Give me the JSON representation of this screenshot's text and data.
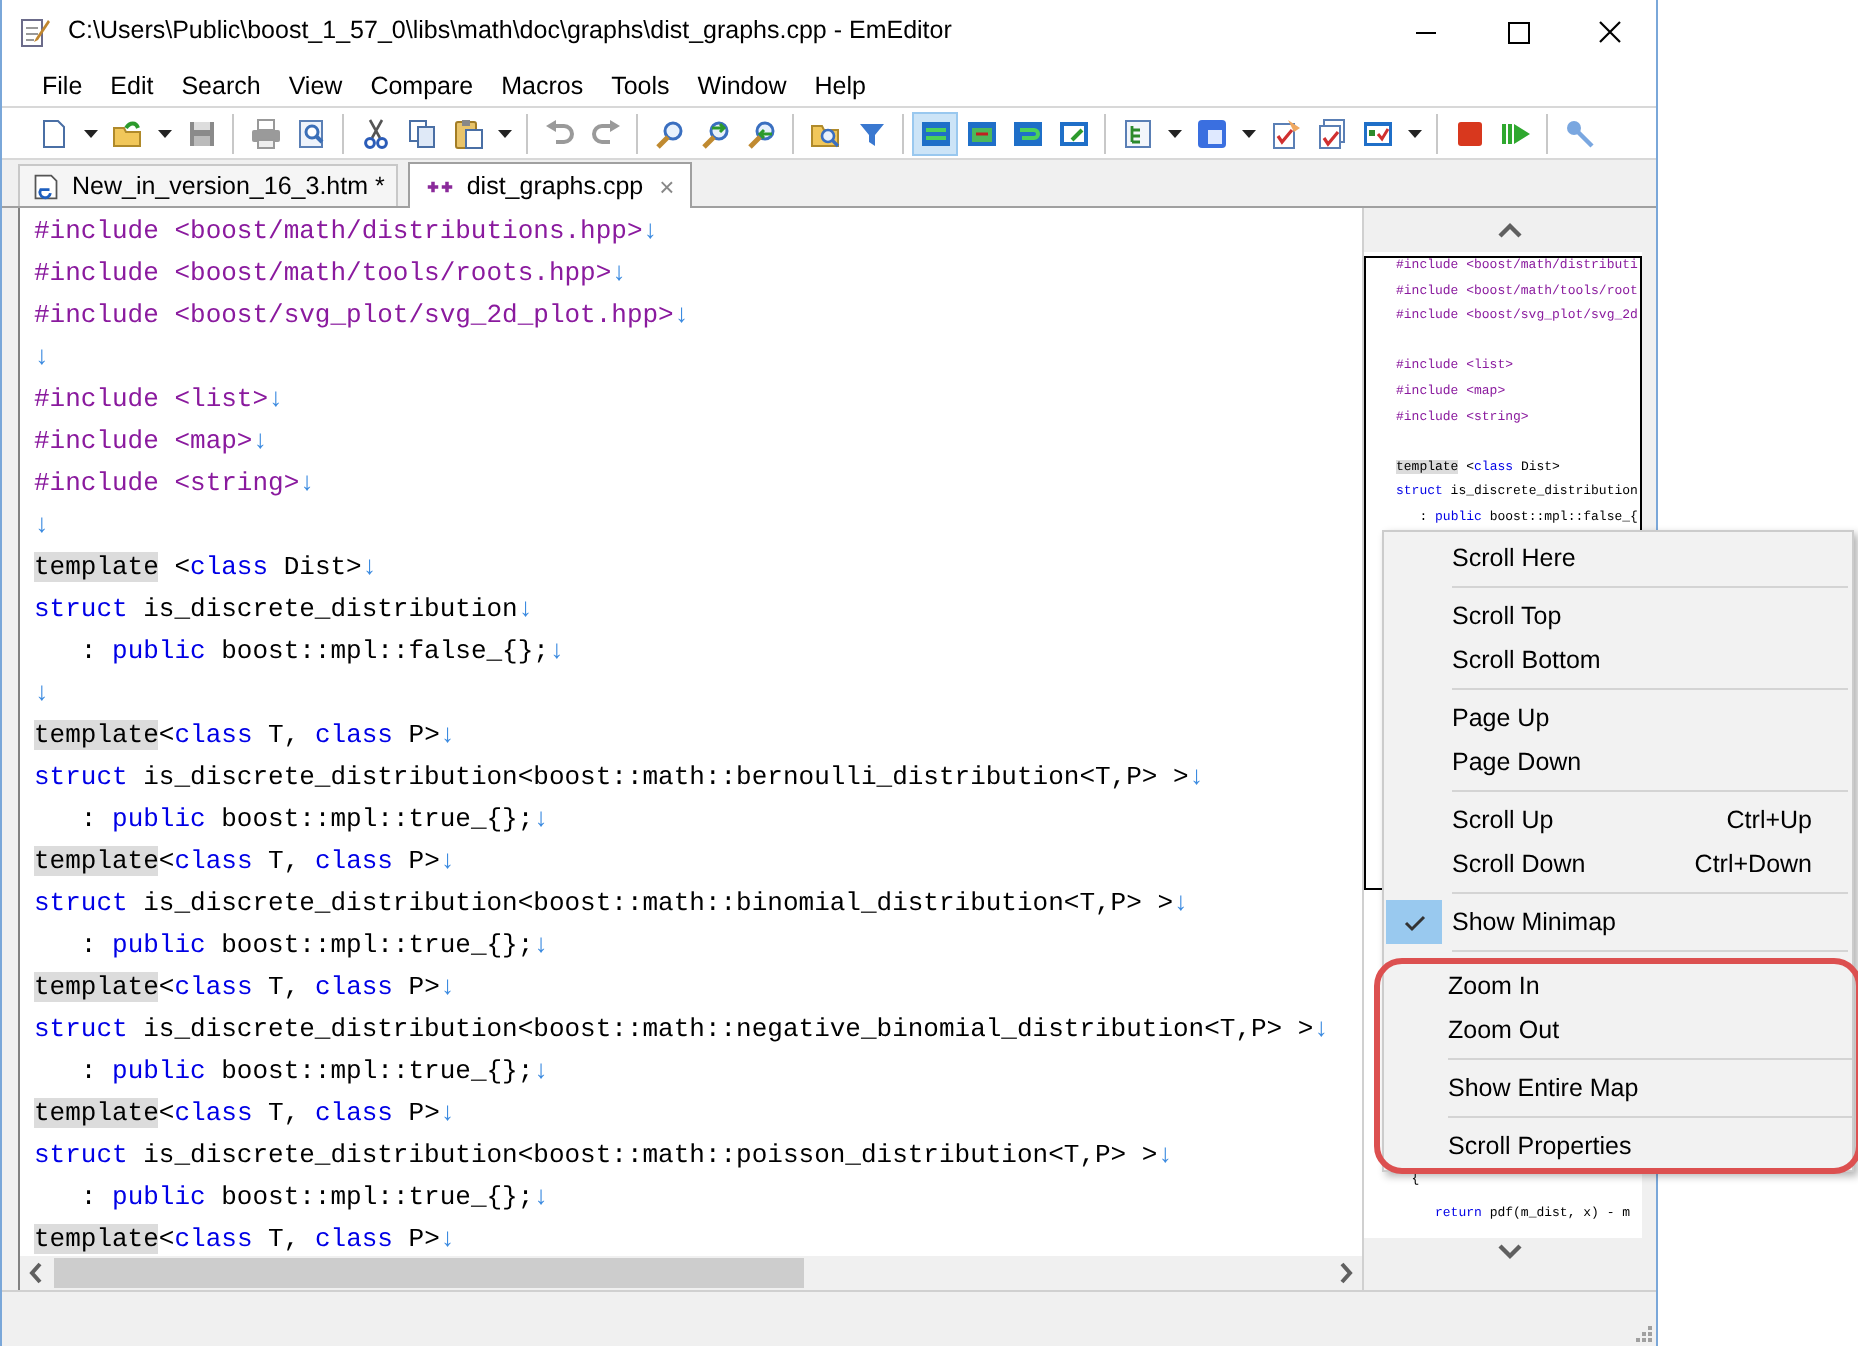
{
  "window": {
    "title": "C:\\Users\\Public\\boost_1_57_0\\libs\\math\\doc\\graphs\\dist_graphs.cpp - EmEditor"
  },
  "menu_bar": [
    "File",
    "Edit",
    "Search",
    "View",
    "Compare",
    "Macros",
    "Tools",
    "Window",
    "Help"
  ],
  "toolbar": [
    {
      "kind": "button",
      "selected": false
    },
    {
      "kind": "dropdown"
    },
    {
      "kind": "button",
      "selected": false
    },
    {
      "kind": "dropdown"
    },
    {
      "kind": "button",
      "selected": false
    },
    {
      "kind": "separator"
    },
    {
      "kind": "button",
      "selected": false
    },
    {
      "kind": "button",
      "selected": false
    },
    {
      "kind": "separator"
    },
    {
      "kind": "button",
      "selected": false
    },
    {
      "kind": "button",
      "selected": false
    },
    {
      "kind": "button",
      "selected": false
    },
    {
      "kind": "dropdown"
    },
    {
      "kind": "separator"
    },
    {
      "kind": "button",
      "selected": false
    },
    {
      "kind": "button",
      "selected": false
    },
    {
      "kind": "separator"
    },
    {
      "kind": "button",
      "selected": false
    },
    {
      "kind": "button",
      "selected": false
    },
    {
      "kind": "button",
      "selected": false
    },
    {
      "kind": "separator"
    },
    {
      "kind": "button",
      "selected": false
    },
    {
      "kind": "button",
      "selected": false
    },
    {
      "kind": "separator"
    },
    {
      "kind": "button",
      "selected": true
    },
    {
      "kind": "button",
      "selected": false
    },
    {
      "kind": "button",
      "selected": false
    },
    {
      "kind": "button",
      "selected": false
    },
    {
      "kind": "separator"
    },
    {
      "kind": "button",
      "selected": false
    },
    {
      "kind": "dropdown"
    },
    {
      "kind": "button",
      "selected": false
    },
    {
      "kind": "dropdown"
    },
    {
      "kind": "button",
      "selected": false
    },
    {
      "kind": "button",
      "selected": false
    },
    {
      "kind": "button",
      "selected": false
    },
    {
      "kind": "dropdown"
    },
    {
      "kind": "separator"
    },
    {
      "kind": "button",
      "selected": false
    },
    {
      "kind": "button",
      "selected": false
    },
    {
      "kind": "separator"
    },
    {
      "kind": "button",
      "selected": false
    }
  ],
  "tabs": [
    {
      "label": "New_in_version_16_3.htm *",
      "kind": "html",
      "selected": false
    },
    {
      "label": "dist_graphs.cpp",
      "kind": "cpp",
      "selected": true,
      "close": "×"
    }
  ],
  "code_lines": [
    [
      {
        "kind": "directive",
        "text": "#include <boost/math/distributions.hpp>"
      },
      {
        "kind": "eol",
        "text": "↓"
      }
    ],
    [
      {
        "kind": "directive",
        "text": "#include <boost/math/tools/roots.hpp>"
      },
      {
        "kind": "eol",
        "text": "↓"
      }
    ],
    [
      {
        "kind": "directive",
        "text": "#include <boost/svg_plot/svg_2d_plot.hpp>"
      },
      {
        "kind": "eol",
        "text": "↓"
      }
    ],
    [
      {
        "kind": "eol",
        "text": "↓"
      }
    ],
    [
      {
        "kind": "directive",
        "text": "#include <list>"
      },
      {
        "kind": "eol",
        "text": "↓"
      }
    ],
    [
      {
        "kind": "directive",
        "text": "#include <map>"
      },
      {
        "kind": "eol",
        "text": "↓"
      }
    ],
    [
      {
        "kind": "directive",
        "text": "#include <string>"
      },
      {
        "kind": "eol",
        "text": "↓"
      }
    ],
    [
      {
        "kind": "eol",
        "text": "↓"
      }
    ],
    [
      {
        "kind": "highlight",
        "text": "template"
      },
      {
        "kind": "text",
        "text": " <"
      },
      {
        "kind": "keyword",
        "text": "class"
      },
      {
        "kind": "text",
        "text": " Dist>"
      },
      {
        "kind": "eol",
        "text": "↓"
      }
    ],
    [
      {
        "kind": "keyword",
        "text": "struct"
      },
      {
        "kind": "text",
        "text": " is_discrete_distribution"
      },
      {
        "kind": "eol",
        "text": "↓"
      }
    ],
    [
      {
        "kind": "text",
        "text": "   : "
      },
      {
        "kind": "keyword",
        "text": "public"
      },
      {
        "kind": "text",
        "text": " boost::mpl::false_{};"
      },
      {
        "kind": "eol",
        "text": "↓"
      }
    ],
    [
      {
        "kind": "eol",
        "text": "↓"
      }
    ],
    [
      {
        "kind": "highlight",
        "text": "template"
      },
      {
        "kind": "text",
        "text": "<"
      },
      {
        "kind": "keyword",
        "text": "class"
      },
      {
        "kind": "text",
        "text": " T, "
      },
      {
        "kind": "keyword",
        "text": "class"
      },
      {
        "kind": "text",
        "text": " P>"
      },
      {
        "kind": "eol",
        "text": "↓"
      }
    ],
    [
      {
        "kind": "keyword",
        "text": "struct"
      },
      {
        "kind": "text",
        "text": " is_discrete_distribution<boost::math::bernoulli_distribution<T,P> >"
      },
      {
        "kind": "eol",
        "text": "↓"
      }
    ],
    [
      {
        "kind": "text",
        "text": "   : "
      },
      {
        "kind": "keyword",
        "text": "public"
      },
      {
        "kind": "text",
        "text": " boost::mpl::true_{};"
      },
      {
        "kind": "eol",
        "text": "↓"
      }
    ],
    [
      {
        "kind": "highlight",
        "text": "template"
      },
      {
        "kind": "text",
        "text": "<"
      },
      {
        "kind": "keyword",
        "text": "class"
      },
      {
        "kind": "text",
        "text": " T, "
      },
      {
        "kind": "keyword",
        "text": "class"
      },
      {
        "kind": "text",
        "text": " P>"
      },
      {
        "kind": "eol",
        "text": "↓"
      }
    ],
    [
      {
        "kind": "keyword",
        "text": "struct"
      },
      {
        "kind": "text",
        "text": " is_discrete_distribution<boost::math::binomial_distribution<T,P> >"
      },
      {
        "kind": "eol",
        "text": "↓"
      }
    ],
    [
      {
        "kind": "text",
        "text": "   : "
      },
      {
        "kind": "keyword",
        "text": "public"
      },
      {
        "kind": "text",
        "text": " boost::mpl::true_{};"
      },
      {
        "kind": "eol",
        "text": "↓"
      }
    ],
    [
      {
        "kind": "highlight",
        "text": "template"
      },
      {
        "kind": "text",
        "text": "<"
      },
      {
        "kind": "keyword",
        "text": "class"
      },
      {
        "kind": "text",
        "text": " T, "
      },
      {
        "kind": "keyword",
        "text": "class"
      },
      {
        "kind": "text",
        "text": " P>"
      },
      {
        "kind": "eol",
        "text": "↓"
      }
    ],
    [
      {
        "kind": "keyword",
        "text": "struct"
      },
      {
        "kind": "text",
        "text": " is_discrete_distribution<boost::math::negative_binomial_distribution<T,P> >"
      },
      {
        "kind": "eol",
        "text": "↓"
      }
    ],
    [
      {
        "kind": "text",
        "text": "   : "
      },
      {
        "kind": "keyword",
        "text": "public"
      },
      {
        "kind": "text",
        "text": " boost::mpl::true_{};"
      },
      {
        "kind": "eol",
        "text": "↓"
      }
    ],
    [
      {
        "kind": "highlight",
        "text": "template"
      },
      {
        "kind": "text",
        "text": "<"
      },
      {
        "kind": "keyword",
        "text": "class"
      },
      {
        "kind": "text",
        "text": " T, "
      },
      {
        "kind": "keyword",
        "text": "class"
      },
      {
        "kind": "text",
        "text": " P>"
      },
      {
        "kind": "eol",
        "text": "↓"
      }
    ],
    [
      {
        "kind": "keyword",
        "text": "struct"
      },
      {
        "kind": "text",
        "text": " is_discrete_distribution<boost::math::poisson_distribution<T,P> >"
      },
      {
        "kind": "eol",
        "text": "↓"
      }
    ],
    [
      {
        "kind": "text",
        "text": "   : "
      },
      {
        "kind": "keyword",
        "text": "public"
      },
      {
        "kind": "text",
        "text": " boost::mpl::true_{};"
      },
      {
        "kind": "eol",
        "text": "↓"
      }
    ],
    [
      {
        "kind": "highlight",
        "text": "template"
      },
      {
        "kind": "text",
        "text": "<"
      },
      {
        "kind": "keyword",
        "text": "class"
      },
      {
        "kind": "text",
        "text": " T, "
      },
      {
        "kind": "keyword",
        "text": "class"
      },
      {
        "kind": "text",
        "text": " P>"
      },
      {
        "kind": "eol",
        "text": "↓"
      }
    ]
  ],
  "minimap": {
    "top_lines": [
      {
        "kind": "code",
        "segments": [
          {
            "kind": "directive",
            "text": "#include <boost/math/distributi"
          }
        ]
      },
      {
        "kind": "code",
        "segments": [
          {
            "kind": "directive",
            "text": "#include <boost/math/tools/root"
          }
        ]
      },
      {
        "kind": "code",
        "segments": [
          {
            "kind": "directive",
            "text": "#include <boost/svg_plot/svg_2d"
          }
        ]
      },
      {
        "kind": "blank"
      },
      {
        "kind": "code",
        "segments": [
          {
            "kind": "directive",
            "text": "#include <list>"
          }
        ]
      },
      {
        "kind": "code",
        "segments": [
          {
            "kind": "directive",
            "text": "#include <map>"
          }
        ]
      },
      {
        "kind": "code",
        "segments": [
          {
            "kind": "directive",
            "text": "#include <string>"
          }
        ]
      },
      {
        "kind": "blank"
      },
      {
        "kind": "code",
        "segments": [
          {
            "kind": "highlight",
            "text": "template"
          },
          {
            "kind": "text",
            "text": " <"
          },
          {
            "kind": "keyword",
            "text": "class"
          },
          {
            "kind": "text",
            "text": " Dist>"
          }
        ]
      },
      {
        "kind": "code",
        "segments": [
          {
            "kind": "keyword",
            "text": "struct"
          },
          {
            "kind": "text",
            "text": " is_discrete_distribution"
          }
        ]
      },
      {
        "kind": "code",
        "segments": [
          {
            "kind": "text",
            "text": "   : "
          },
          {
            "kind": "keyword",
            "text": "public"
          },
          {
            "kind": "text",
            "text": " boost::mpl::false_{"
          }
        ]
      }
    ],
    "bottom_lines": [
      {
        "kind": "code",
        "segments": [
          {
            "kind": "text",
            "text": "  {"
          }
        ]
      },
      {
        "kind": "code",
        "segments": [
          {
            "kind": "keyword",
            "text": "     return"
          },
          {
            "kind": "text",
            "text": " pdf(m_dist, x) - m"
          }
        ]
      }
    ]
  },
  "context_menu": [
    {
      "kind": "item",
      "label": "Scroll Here",
      "checked": false,
      "outlined": false
    },
    {
      "kind": "separator",
      "outlined": false
    },
    {
      "kind": "item",
      "label": "Scroll Top",
      "checked": false,
      "outlined": false
    },
    {
      "kind": "item",
      "label": "Scroll Bottom",
      "checked": false,
      "outlined": false
    },
    {
      "kind": "separator",
      "outlined": false
    },
    {
      "kind": "item",
      "label": "Page Up",
      "checked": false,
      "outlined": false
    },
    {
      "kind": "item",
      "label": "Page Down",
      "checked": false,
      "outlined": false
    },
    {
      "kind": "separator",
      "outlined": false
    },
    {
      "kind": "item",
      "label": "Scroll Up",
      "shortcut": "Ctrl+Up",
      "checked": false,
      "outlined": false
    },
    {
      "kind": "item",
      "label": "Scroll Down",
      "shortcut": "Ctrl+Down",
      "checked": false,
      "outlined": false
    },
    {
      "kind": "separator",
      "outlined": false
    },
    {
      "kind": "item",
      "label": "Show Minimap",
      "checked": true,
      "outlined": false
    },
    {
      "kind": "separator",
      "outlined": false
    },
    {
      "kind": "item",
      "label": "Zoom In",
      "checked": false,
      "outlined": true
    },
    {
      "kind": "item",
      "label": "Zoom Out",
      "checked": false,
      "outlined": true
    },
    {
      "kind": "separator",
      "outlined": true
    },
    {
      "kind": "item",
      "label": "Show Entire Map",
      "checked": false,
      "outlined": true
    },
    {
      "kind": "separator",
      "outlined": true
    },
    {
      "kind": "item",
      "label": "Scroll Properties",
      "checked": false,
      "outlined": true
    }
  ]
}
